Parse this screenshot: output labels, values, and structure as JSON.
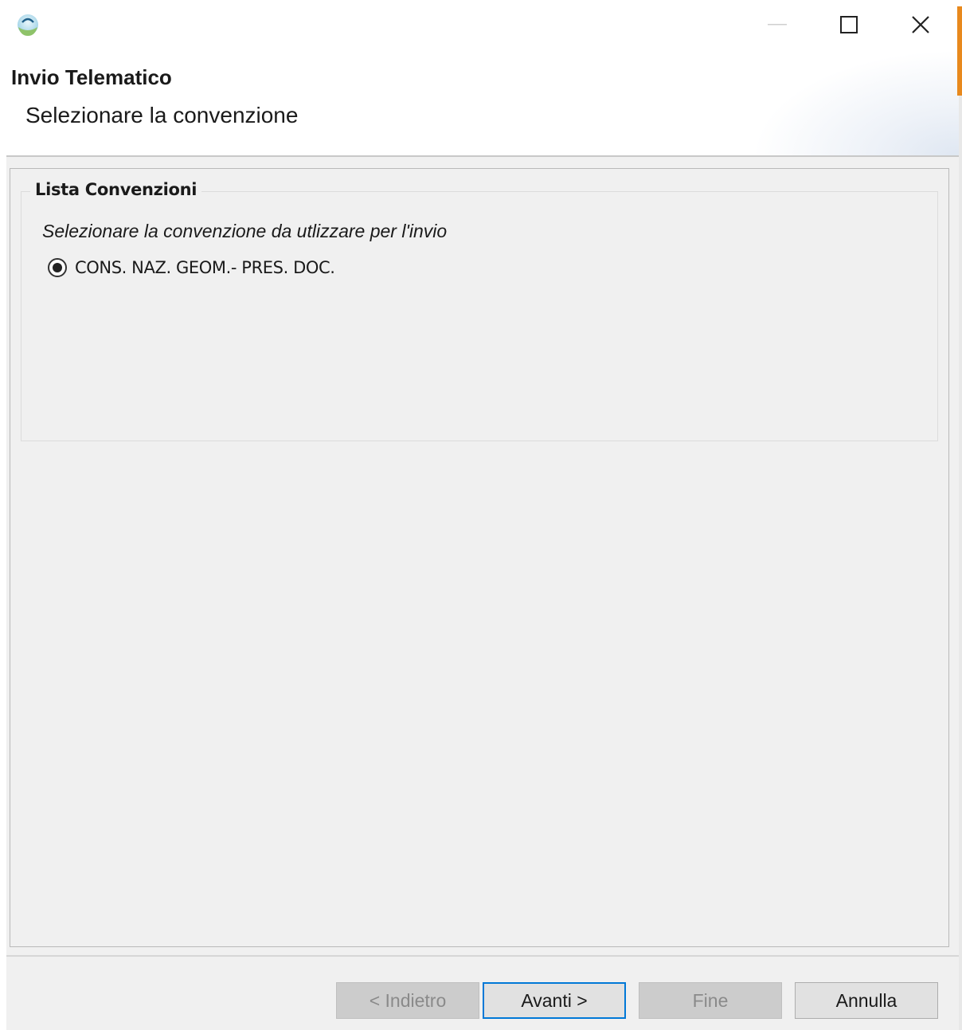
{
  "window": {
    "title": "Invio Telematico",
    "subtitle": "Selezionare la convenzione",
    "icons": {
      "app": "app-logo-icon",
      "minimize": "minimize-icon",
      "maximize": "maximize-icon",
      "close": "close-icon"
    }
  },
  "group": {
    "legend": "Lista Convenzioni",
    "description": "Selezionare la convenzione da utlizzare per l'invio",
    "options": [
      {
        "label": "CONS. NAZ. GEOM.- PRES. DOC.",
        "selected": true
      }
    ]
  },
  "buttons": {
    "back": "< Indietro",
    "next": "Avanti >",
    "finish": "Fine",
    "cancel": "Annulla"
  },
  "colors": {
    "focus_border": "#0078d7",
    "accent": "#e8891d",
    "body_background": "#f0f0f0"
  }
}
